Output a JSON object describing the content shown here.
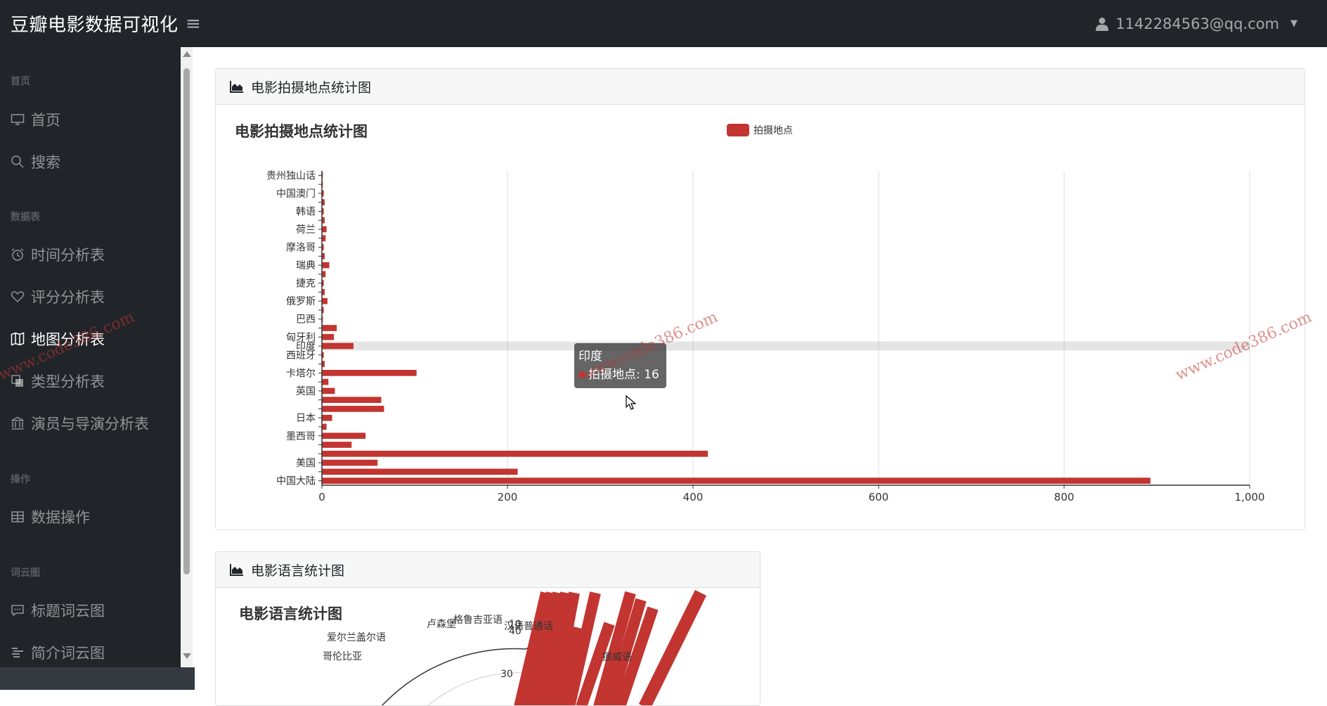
{
  "app": {
    "title": "豆瓣电影数据可视化",
    "user_email": "1142284563@qq.com"
  },
  "sidebar": {
    "headings": [
      "首页",
      "数据表",
      "操作",
      "词云图"
    ],
    "items": [
      {
        "label": "首页",
        "icon": "monitor-icon"
      },
      {
        "label": "搜索",
        "icon": "search-icon"
      },
      {
        "label": "时间分析表",
        "icon": "alarm-clock-icon"
      },
      {
        "label": "评分分析表",
        "icon": "heart-icon"
      },
      {
        "label": "地图分析表",
        "icon": "map-icon"
      },
      {
        "label": "类型分析表",
        "icon": "copy-icon"
      },
      {
        "label": "演员与导演分析表",
        "icon": "bank-icon"
      },
      {
        "label": "数据操作",
        "icon": "table-icon"
      },
      {
        "label": "标题词云图",
        "icon": "comment-icon"
      },
      {
        "label": "简介词云图",
        "icon": "stream-icon"
      }
    ],
    "active": "地图分析表"
  },
  "card1": {
    "header": "电影拍摄地点统计图"
  },
  "card2": {
    "header": "电影语言统计图"
  },
  "watermark": "www.code386.com",
  "tooltip": {
    "name": "印度",
    "series": "拍摄地点",
    "value": 16,
    "text": "拍摄地点: 16"
  },
  "colors": {
    "bar": "#c23531",
    "dark": "#212529"
  },
  "chart_data": [
    {
      "type": "bar",
      "orientation": "horizontal",
      "title": "电影拍摄地点统计图",
      "legend": [
        "拍摄地点"
      ],
      "legend_position": "top-center",
      "xlim": [
        0,
        1000
      ],
      "x_ticks": [
        0,
        200,
        400,
        600,
        800,
        1000
      ],
      "x_tick_labels": [
        "0",
        "200",
        "400",
        "600",
        "800",
        "1,000"
      ],
      "categories": [
        "中国大陆",
        "",
        "美国",
        "",
        "",
        "墨西哥",
        "",
        "日本",
        "",
        "",
        "英国",
        "",
        "卡塔尔",
        "",
        "西班牙",
        "印度",
        "匈牙利",
        "",
        "巴西",
        "",
        "俄罗斯",
        "",
        "捷克",
        "",
        "瑞典",
        "",
        "摩洛哥",
        "",
        "荷兰",
        "",
        "韩语",
        "",
        "中国澳门",
        "",
        "贵州独山话"
      ],
      "series": [
        {
          "name": "拍摄地点",
          "values": [
            893,
            211,
            60,
            416,
            32,
            47,
            5,
            11,
            67,
            64,
            14,
            7,
            102,
            3,
            2,
            34,
            13,
            16,
            1,
            2,
            6,
            3,
            2,
            4,
            8,
            3,
            2,
            4,
            5,
            3,
            2,
            3,
            2,
            1,
            1
          ]
        }
      ],
      "grid": true
    },
    {
      "type": "bar",
      "subtype": "polar",
      "title": "电影语言统计图",
      "visible_labels": [
        "爱尔兰盖尔语",
        "卢森堡",
        "格鲁吉亚语",
        "汉语普通话",
        "哥伦比亚",
        "挪威语"
      ],
      "radial_ticks": [
        10,
        30,
        40
      ]
    }
  ]
}
